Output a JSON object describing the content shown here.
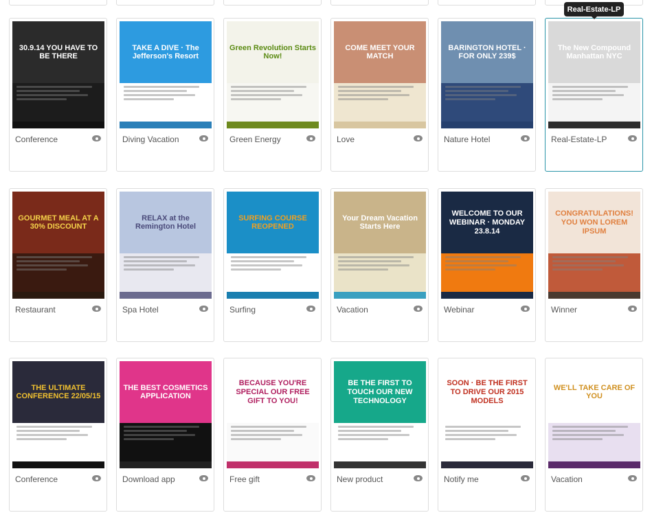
{
  "tooltip": "Real-Estate-LP",
  "templates": [
    {
      "name": "Conference",
      "headline": "30.9.14 YOU HAVE TO BE THERE",
      "colors": [
        "#2b2b2b",
        "#1c1c1c",
        "#111"
      ],
      "fg": "#fff"
    },
    {
      "name": "Diving Vacation",
      "headline": "TAKE A DIVE · The Jefferson's Resort",
      "colors": [
        "#2d9be0",
        "#ffffff",
        "#2a7fb8"
      ],
      "fg": "#fff"
    },
    {
      "name": "Green Energy",
      "headline": "Green Revolution Starts Now!",
      "colors": [
        "#f3f3ea",
        "#f7f7f2",
        "#6e8a1e"
      ],
      "fg": "#5a8a12"
    },
    {
      "name": "Love",
      "headline": "COME MEET YOUR MATCH",
      "colors": [
        "#c98f74",
        "#efe6d0",
        "#d8c6a0"
      ],
      "fg": "#fff"
    },
    {
      "name": "Nature Hotel",
      "headline": "BARINGTON HOTEL · FOR ONLY 239$",
      "colors": [
        "#6f8fb0",
        "#2f4a7a",
        "#26406e"
      ],
      "fg": "#fff"
    },
    {
      "name": "Real-Estate-LP",
      "headline": "The New Compound Manhattan NYC",
      "colors": [
        "#d9d9d9",
        "#f4f4f4",
        "#2d2d2d"
      ],
      "fg": "#fff"
    },
    {
      "name": "Restaurant",
      "headline": "GOURMET MEAL AT A 30% DISCOUNT",
      "colors": [
        "#7a2a1a",
        "#3a1a10",
        "#2a1a10"
      ],
      "fg": "#f5d24a"
    },
    {
      "name": "Spa Hotel",
      "headline": "RELAX at the Remington Hotel",
      "colors": [
        "#b8c6e0",
        "#e8e8f0",
        "#6b6b8f"
      ],
      "fg": "#4a4a7a"
    },
    {
      "name": "Surfing",
      "headline": "SURFING COURSE REOPENED",
      "colors": [
        "#1b8fc7",
        "#ffffff",
        "#1a7fb0"
      ],
      "fg": "#f0a020"
    },
    {
      "name": "Vacation",
      "headline": "Your Dream Vacation Starts Here",
      "colors": [
        "#c9b48a",
        "#eae3c8",
        "#3aa0c0"
      ],
      "fg": "#fff"
    },
    {
      "name": "Webinar",
      "headline": "WELCOME TO OUR WEBINAR · MONDAY 23.8.14",
      "colors": [
        "#1a2a44",
        "#f07a10",
        "#1a2a44"
      ],
      "fg": "#fff"
    },
    {
      "name": "Winner",
      "headline": "CONGRATULATIONS! YOU WON LOREM IPSUM",
      "colors": [
        "#f2e4d8",
        "#c05a3a",
        "#4a3a30"
      ],
      "fg": "#e08040"
    },
    {
      "name": "Conference",
      "headline": "THE ULTIMATE CONFERENCE 22/05/15",
      "colors": [
        "#2a2a3a",
        "#ffffff",
        "#111"
      ],
      "fg": "#f0c030"
    },
    {
      "name": "Download app",
      "headline": "THE BEST COSMETICS APPLICATION",
      "colors": [
        "#e0358a",
        "#111111",
        "#222"
      ],
      "fg": "#fff"
    },
    {
      "name": "Free gift",
      "headline": "BECAUSE YOU'RE SPECIAL OUR FREE GIFT TO YOU!",
      "colors": [
        "#ffffff",
        "#fafafa",
        "#c0306a"
      ],
      "fg": "#b02060"
    },
    {
      "name": "New product",
      "headline": "BE THE FIRST TO TOUCH OUR NEW TECHNOLOGY",
      "colors": [
        "#16a88a",
        "#ffffff",
        "#333"
      ],
      "fg": "#fff"
    },
    {
      "name": "Notify me",
      "headline": "SOON · BE THE FIRST TO DRIVE OUR 2015 MODELS",
      "colors": [
        "#ffffff",
        "#ffffff",
        "#2a2a3a"
      ],
      "fg": "#c03020"
    },
    {
      "name": "Vacation",
      "headline": "WE'LL TAKE CARE OF YOU",
      "colors": [
        "#ffffff",
        "#e8dff0",
        "#5a2a6a"
      ],
      "fg": "#d09020"
    }
  ]
}
